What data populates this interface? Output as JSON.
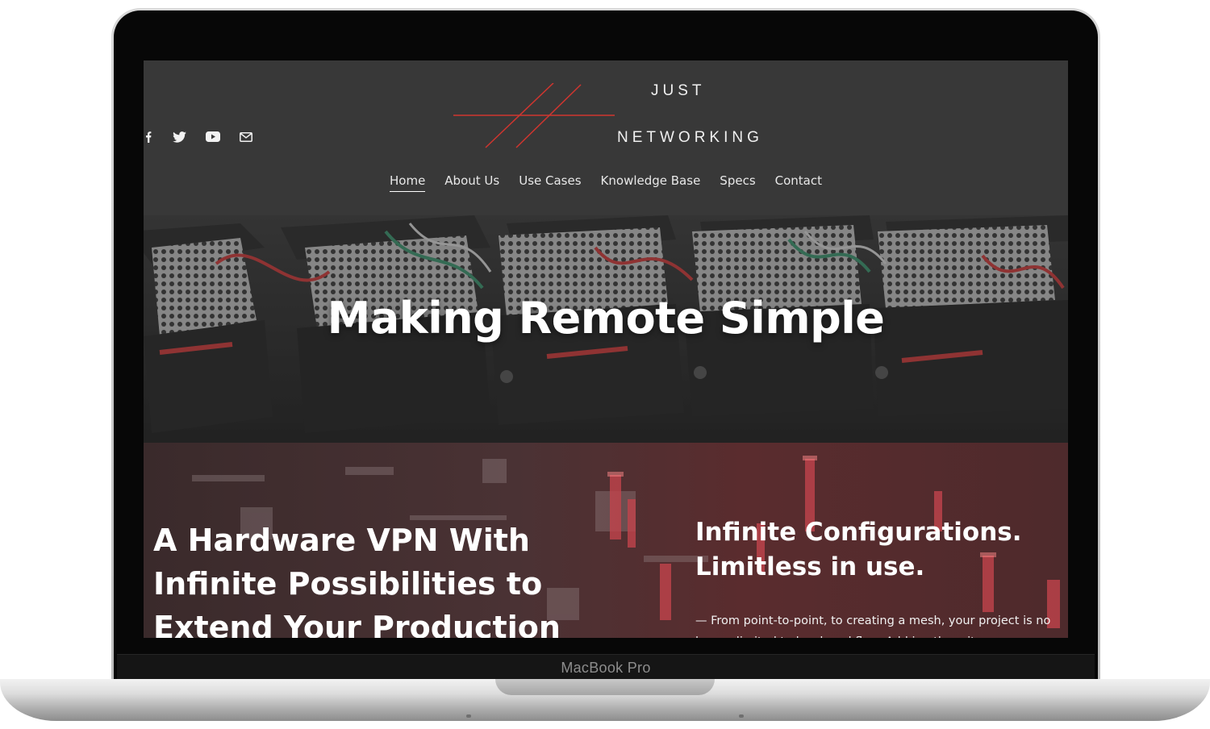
{
  "device": {
    "brand_label": "MacBook Pro"
  },
  "site": {
    "logo": {
      "line1": "JUST",
      "line2": "NETWORKING",
      "accent": "#d0352f"
    },
    "social": [
      {
        "icon": "facebook-icon"
      },
      {
        "icon": "twitter-icon"
      },
      {
        "icon": "youtube-icon"
      },
      {
        "icon": "email-icon"
      }
    ],
    "nav": [
      {
        "label": "Home",
        "active": true
      },
      {
        "label": "About Us"
      },
      {
        "label": "Use Cases"
      },
      {
        "label": "Knowledge Base"
      },
      {
        "label": "Specs"
      },
      {
        "label": "Contact"
      }
    ],
    "hero": {
      "title": "Making Remote Simple"
    },
    "feature": {
      "left_heading": "A Hardware VPN With Infinite Possibilities to Extend Your Production",
      "right_heading": "Infinite Configurations. Limitless in use.",
      "right_body": "— From point-to-point, to creating a mesh, your project is no longer limited to local workflow. Add in other sites, as"
    }
  }
}
